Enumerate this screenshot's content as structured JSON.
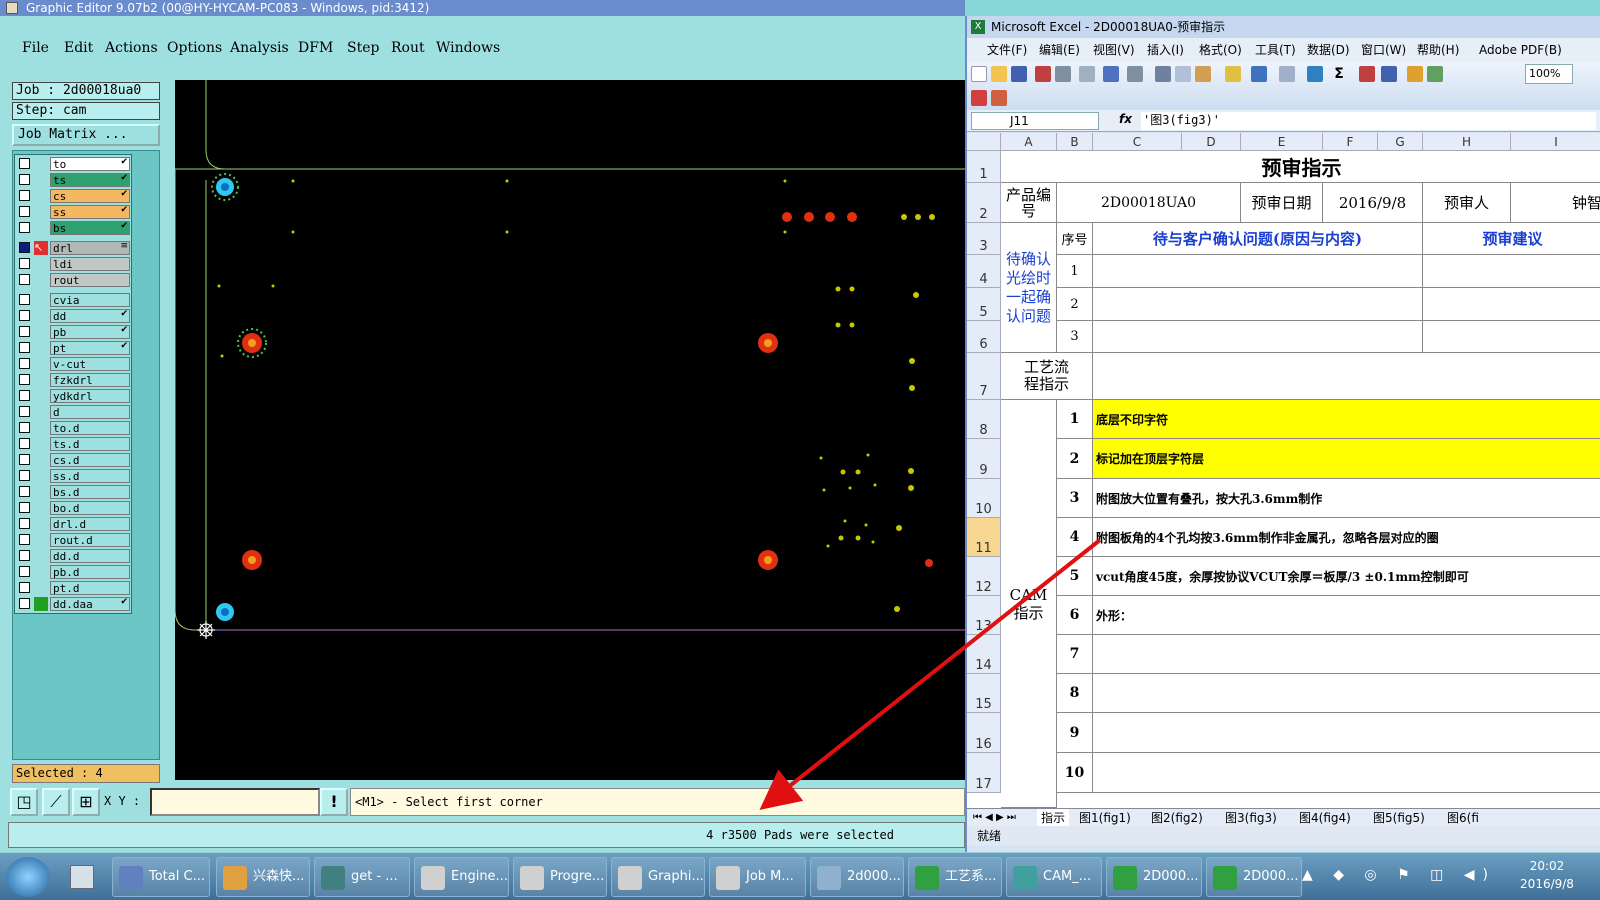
{
  "graphic_editor": {
    "title": "Graphic Editor 9.07b2 (00@HY-HYCAM-PC083 - Windows, pid:3412)",
    "menu": [
      "File",
      "Edit",
      "Actions",
      "Options",
      "Analysis",
      "DFM",
      "Step",
      "Rout",
      "Windows"
    ],
    "job_label": "Job : 2d00018ua0",
    "step_label": "Step: cam",
    "job_matrix": "Job Matrix ...",
    "layers": [
      {
        "name": "to",
        "color": "#ffffff",
        "tick": "✔"
      },
      {
        "name": "ts",
        "color": "#2fa070",
        "tick": "✔"
      },
      {
        "name": "cs",
        "color": "#f4b860",
        "tick": "✔"
      },
      {
        "name": "ss",
        "color": "#f4b860",
        "tick": "✔"
      },
      {
        "name": "bs",
        "color": "#2fa070",
        "tick": "✔"
      },
      {
        "name": "drl",
        "color": "#b0b8b8",
        "tick": "≡",
        "active": true
      },
      {
        "name": "ldi",
        "color": "#c0c8c8",
        "tick": ""
      },
      {
        "name": "rout",
        "color": "#c0c8c8",
        "tick": ""
      },
      {
        "name": "cvia",
        "color": "#9ee0e0",
        "tick": ""
      },
      {
        "name": "dd",
        "color": "#9ee0e0",
        "tick": "✔"
      },
      {
        "name": "pb",
        "color": "#9ee0e0",
        "tick": "✔"
      },
      {
        "name": "pt",
        "color": "#9ee0e0",
        "tick": "✔"
      },
      {
        "name": "v-cut",
        "color": "#9ee0e0",
        "tick": ""
      },
      {
        "name": "fzkdrl",
        "color": "#9ee0e0",
        "tick": ""
      },
      {
        "name": "ydkdrl",
        "color": "#9ee0e0",
        "tick": ""
      },
      {
        "name": "d",
        "color": "#9ee0e0",
        "tick": ""
      },
      {
        "name": "to.d",
        "color": "#9ee0e0",
        "tick": ""
      },
      {
        "name": "ts.d",
        "color": "#9ee0e0",
        "tick": ""
      },
      {
        "name": "cs.d",
        "color": "#9ee0e0",
        "tick": ""
      },
      {
        "name": "ss.d",
        "color": "#9ee0e0",
        "tick": ""
      },
      {
        "name": "bs.d",
        "color": "#9ee0e0",
        "tick": ""
      },
      {
        "name": "bo.d",
        "color": "#9ee0e0",
        "tick": ""
      },
      {
        "name": "drl.d",
        "color": "#9ee0e0",
        "tick": ""
      },
      {
        "name": "rout.d",
        "color": "#9ee0e0",
        "tick": ""
      },
      {
        "name": "dd.d",
        "color": "#9ee0e0",
        "tick": ""
      },
      {
        "name": "pb.d",
        "color": "#9ee0e0",
        "tick": ""
      },
      {
        "name": "pt.d",
        "color": "#9ee0e0",
        "tick": ""
      },
      {
        "name": "dd.daa",
        "color": "#9ee0e0",
        "tick": "✔"
      }
    ],
    "selected": "Selected : 4",
    "xy_label": "X Y :",
    "xy_value": "",
    "prompt": "<M1> - Select first corner",
    "status": "4 r3500 Pads were selected"
  },
  "excel": {
    "title": "Microsoft Excel - 2D00018UA0-预审指示",
    "menu": [
      "文件(F)",
      "编辑(E)",
      "视图(V)",
      "插入(I)",
      "格式(O)",
      "工具(T)",
      "数据(D)",
      "窗口(W)",
      "帮助(H)",
      "Adobe PDF(B)"
    ],
    "zoom": "100%",
    "name_box": "J11",
    "formula": "'图3(fig3)'",
    "columns": [
      "A",
      "B",
      "C",
      "D",
      "E",
      "F",
      "G",
      "H",
      "I"
    ],
    "rows": [
      "1",
      "2",
      "3",
      "4",
      "5",
      "6",
      "7",
      "8",
      "9",
      "10",
      "11",
      "12",
      "13",
      "14",
      "15",
      "16",
      "17"
    ],
    "sheet": {
      "title": "预审指示",
      "product_label": "产品编号",
      "product_no": "2D00018UA0",
      "date_label": "预审日期",
      "date": "2016/9/8",
      "reviewer_label": "预审人",
      "reviewer": "钟智",
      "seq_label": "序号",
      "issue_header": "待与客户确认问题(原因与内容)",
      "suggest_header": "预审建议",
      "pending_label": "待确认光绘时一起确认问题",
      "pending_nums": [
        "1",
        "2",
        "3"
      ],
      "process_label": "工艺流程指示",
      "cam_label": "CAM指示",
      "cam_rows": [
        {
          "no": "1",
          "text": "底层不印字符"
        },
        {
          "no": "2",
          "text": "标记加在顶层字符层"
        },
        {
          "no": "3",
          "text": "附图放大位置有叠孔，按大孔3.6mm制作"
        },
        {
          "no": "4",
          "text": "附图板角的4个孔均按3.6mm制作非金属孔，忽略各层对应的圈"
        },
        {
          "no": "5",
          "text": "vcut角度45度，余厚按协议VCUT余厚＝板厚/3  ±0.1mm控制即可"
        },
        {
          "no": "6",
          "text": "外形："
        },
        {
          "no": "7",
          "text": ""
        },
        {
          "no": "8",
          "text": ""
        },
        {
          "no": "9",
          "text": ""
        },
        {
          "no": "10",
          "text": ""
        }
      ]
    },
    "tabs": [
      "指示",
      "图1(fig1)",
      "图2(fig2)",
      "图3(fig3)",
      "图4(fig4)",
      "图5(fig5)",
      "图6(fi"
    ],
    "status": "就绪"
  },
  "taskbar": {
    "items": [
      "Total C...",
      "兴森快...",
      "get - ...",
      "Engine...",
      "Progre...",
      "Graphi...",
      "Job M...",
      "2d000...",
      "工艺系...",
      "CAM_...",
      "2D000...",
      "2D000..."
    ],
    "time": "20:02",
    "date": "2016/9/8"
  },
  "colors": {
    "ge_bg": "#9ee0e0",
    "canvas_bg": "#000000",
    "pad_red": "#e03010",
    "pad_cyan": "#30c8f0",
    "highlight_yellow": "#ffff00",
    "arrow_red": "#e01010"
  }
}
